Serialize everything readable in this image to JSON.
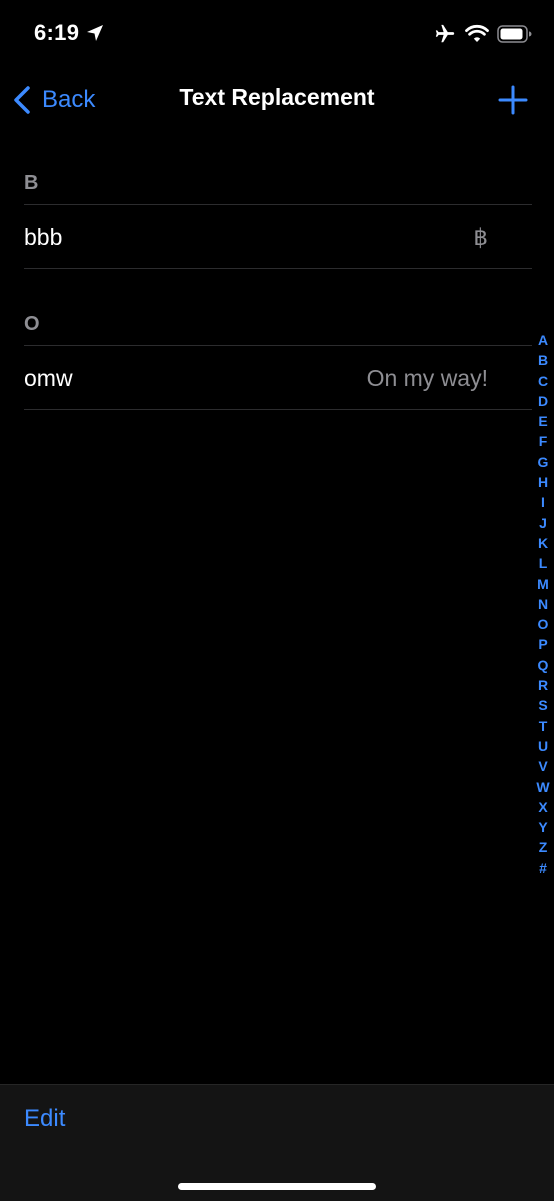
{
  "status_bar": {
    "time": "6:19",
    "icons": [
      "location-arrow-icon",
      "airplane-icon",
      "wifi-icon",
      "battery-icon"
    ]
  },
  "nav": {
    "back_label": "Back",
    "title": "Text Replacement",
    "add_icon": "plus-icon"
  },
  "sections": [
    {
      "header": "B",
      "rows": [
        {
          "phrase": "bbb",
          "shortcut": "฿"
        }
      ]
    },
    {
      "header": "O",
      "rows": [
        {
          "phrase": "omw",
          "shortcut": "On my way!"
        }
      ]
    }
  ],
  "index_letters": [
    "A",
    "B",
    "C",
    "D",
    "E",
    "F",
    "G",
    "H",
    "I",
    "J",
    "K",
    "L",
    "M",
    "N",
    "O",
    "P",
    "Q",
    "R",
    "S",
    "T",
    "U",
    "V",
    "W",
    "X",
    "Y",
    "Z",
    "#"
  ],
  "toolbar": {
    "edit_label": "Edit"
  },
  "colors": {
    "accent": "#3c8aff",
    "background": "#000000",
    "secondary_text": "#8e8e93",
    "separator": "#2c2c2e",
    "toolbar_bg": "#141414"
  }
}
